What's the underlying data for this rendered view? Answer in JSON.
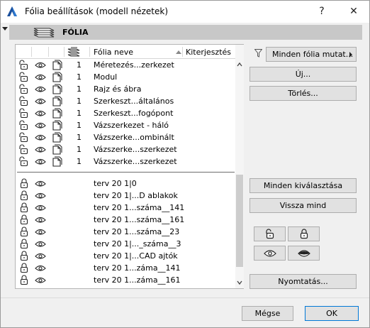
{
  "window": {
    "title": "Fólia beállítások (modell nézetek)",
    "help_label": "?",
    "close_label": "✕"
  },
  "section": {
    "title": "FÓLIA"
  },
  "table": {
    "col_name": "Fólia neve",
    "col_extension": "Kiterjesztés",
    "top_rows": [
      {
        "num": "1",
        "name": "Méretezés...zerkezet"
      },
      {
        "num": "1",
        "name": "Modul"
      },
      {
        "num": "1",
        "name": "Rajz és ábra"
      },
      {
        "num": "1",
        "name": "Szerkeszt...általános"
      },
      {
        "num": "1",
        "name": "Szerkeszt...fogópont"
      },
      {
        "num": "1",
        "name": "Vázszerkezet - háló"
      },
      {
        "num": "1",
        "name": "Vázszerke...ombinált"
      },
      {
        "num": "1",
        "name": "Vázszerke...szerkezet"
      },
      {
        "num": "1",
        "name": "Vázszerke...szerkezet"
      }
    ],
    "bottom_rows": [
      {
        "name": "terv 20 1|0"
      },
      {
        "name": "terv 20 1|...D ablakok"
      },
      {
        "name": "terv 20 1...száma__141"
      },
      {
        "name": "terv 20 1...száma__161"
      },
      {
        "name": "terv 20 1...száma__23"
      },
      {
        "name": "terv 20 1|..._száma__3"
      },
      {
        "name": "terv 20 1|...CAD ajtók"
      },
      {
        "name": "terv 20 1...záma__141"
      },
      {
        "name": "terv 20 1...záma__161"
      }
    ]
  },
  "right_panel": {
    "filter_label": "Minden fólia mutat...",
    "new_label": "Új...",
    "delete_label": "Törlés...",
    "select_all_label": "Minden kiválasztása",
    "revert_all_label": "Vissza mind",
    "print_label": "Nyomtatás..."
  },
  "footer": {
    "cancel_label": "Mégse",
    "ok_label": "OK"
  }
}
